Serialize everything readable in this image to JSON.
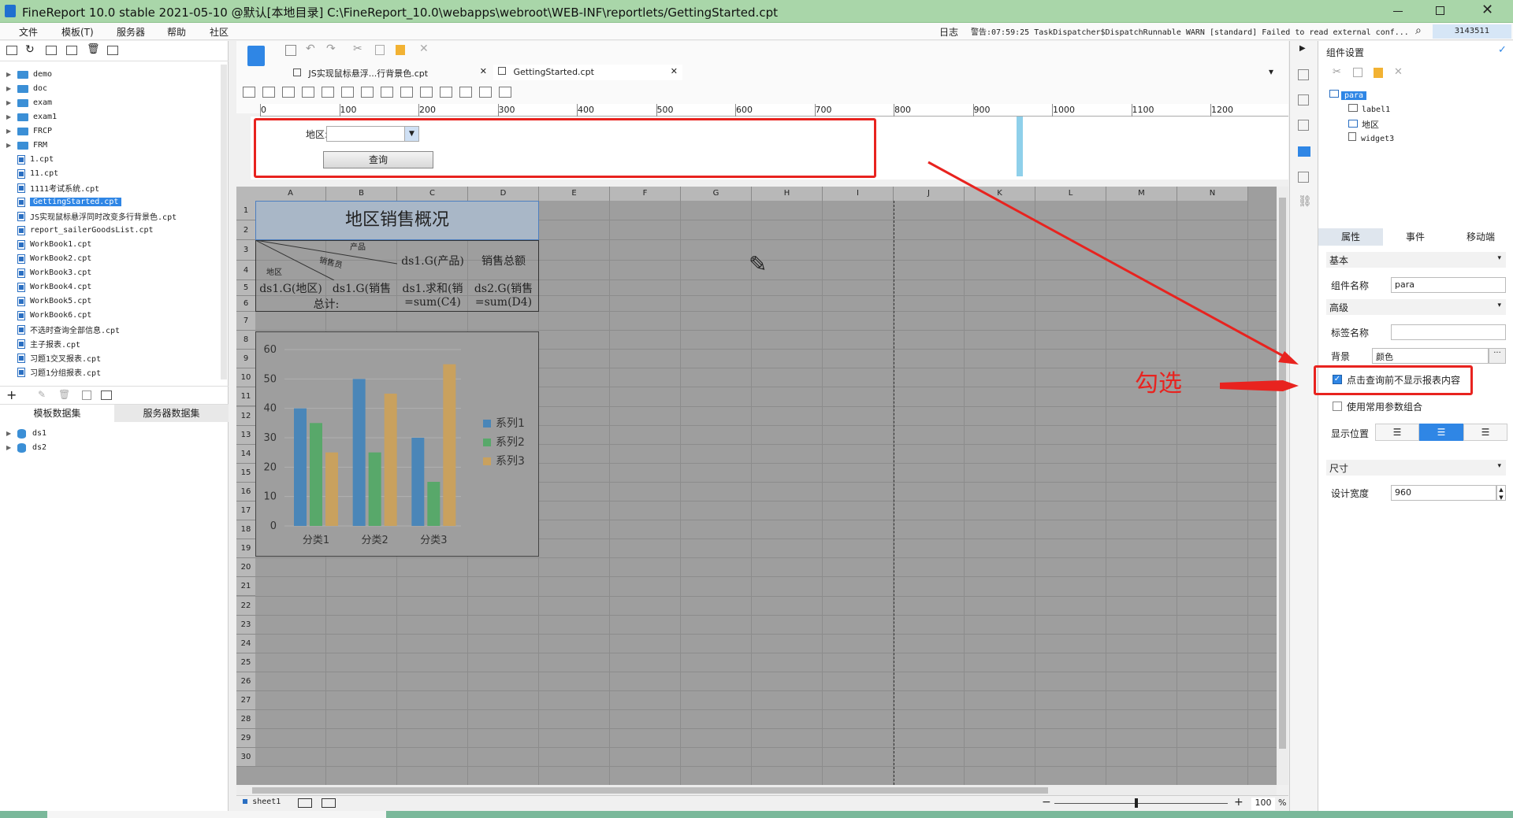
{
  "window": {
    "title": "FineReport 10.0 stable 2021-05-10 @默认[本地目录]    C:\\FineReport_10.0\\webapps\\webroot\\WEB-INF\\reportlets/GettingStarted.cpt"
  },
  "menu": [
    "文件",
    "模板(T)",
    "服务器",
    "帮助",
    "社区"
  ],
  "log": {
    "label": "日志",
    "warning": "警告:07:59:25 TaskDispatcher$DispatchRunnable WARN [standard] Failed to read external conf...",
    "user_id": "3143511"
  },
  "file_tree": {
    "folders": [
      "demo",
      "doc",
      "exam",
      "exam1",
      "FRCP",
      "FRM"
    ],
    "files": [
      "1.cpt",
      "11.cpt",
      "1111考试系统.cpt",
      "GettingStarted.cpt",
      "JS实现鼠标悬浮同时改变多行背景色.cpt",
      "report_sailerGoodsList.cpt",
      "WorkBook1.cpt",
      "WorkBook2.cpt",
      "WorkBook3.cpt",
      "WorkBook4.cpt",
      "WorkBook5.cpt",
      "WorkBook6.cpt",
      "不选时查询全部信息.cpt",
      "主子报表.cpt",
      "习题1交叉报表.cpt",
      "习题1分组报表.cpt"
    ]
  },
  "dataset_tabs": [
    "模板数据集",
    "服务器数据集"
  ],
  "datasets": [
    "ds1",
    "ds2"
  ],
  "editor_tabs": [
    "JS实现鼠标悬浮...行背景色.cpt",
    "GettingStarted.cpt"
  ],
  "ruler": [
    "0",
    "100",
    "200",
    "300",
    "400",
    "500",
    "600",
    "700",
    "800",
    "900",
    "1000",
    "1100",
    "1200"
  ],
  "param": {
    "label": "地区:",
    "button": "查询"
  },
  "columns": [
    "A",
    "B",
    "C",
    "D",
    "E",
    "F",
    "G",
    "H",
    "I",
    "J",
    "K",
    "L",
    "M",
    "N"
  ],
  "rows": [
    "1",
    "2",
    "3",
    "4",
    "5",
    "6",
    "7",
    "8",
    "9",
    "10",
    "11",
    "12",
    "13",
    "14",
    "15",
    "16",
    "17",
    "18",
    "19",
    "20",
    "21",
    "22",
    "23",
    "24",
    "25",
    "26",
    "27",
    "28",
    "29",
    "30"
  ],
  "report": {
    "title": "地区销售概况",
    "diag_product": "产品",
    "diag_seller": "销售员",
    "diag_region": "地区",
    "c3": "ds1.G(产品)",
    "d3": "销售总额",
    "a4": "ds1.G(地区)",
    "b4": "ds1.G(销售",
    "c4": "ds1.求和(销",
    "d4": "ds2.G(销售",
    "a5": "总计:",
    "c5": "=sum(C4)",
    "d5": "=sum(D4)"
  },
  "chart_data": {
    "type": "bar",
    "categories": [
      "分类1",
      "分类2",
      "分类3"
    ],
    "series": [
      {
        "name": "系列1",
        "values": [
          40,
          50,
          30
        ],
        "color": "#4a86b8"
      },
      {
        "name": "系列2",
        "values": [
          35,
          25,
          15
        ],
        "color": "#58a86a"
      },
      {
        "name": "系列3",
        "values": [
          25,
          45,
          55
        ],
        "color": "#c9a15e"
      }
    ],
    "yticks": [
      "0",
      "10",
      "20",
      "30",
      "40",
      "50",
      "60"
    ],
    "ylim": [
      0,
      60
    ],
    "legend": "right"
  },
  "right_panel": {
    "title": "组件设置",
    "tree": [
      "para",
      "label1",
      "地区",
      "widget3"
    ],
    "tabs": [
      "属性",
      "事件",
      "移动端"
    ],
    "basic": "基本",
    "name_label": "组件名称",
    "name_value": "para",
    "advanced": "高级",
    "tag_label": "标签名称",
    "bg_label": "背景",
    "bg_value": "颜色",
    "check1": "点击查询前不显示报表内容",
    "check2": "使用常用参数组合",
    "pos_label": "显示位置",
    "size": "尺寸",
    "width_label": "设计宽度",
    "width_value": "960"
  },
  "annotation": {
    "text": "勾选"
  },
  "status": {
    "sheet": "sheet1",
    "zoom": "100",
    "pct": "%"
  }
}
